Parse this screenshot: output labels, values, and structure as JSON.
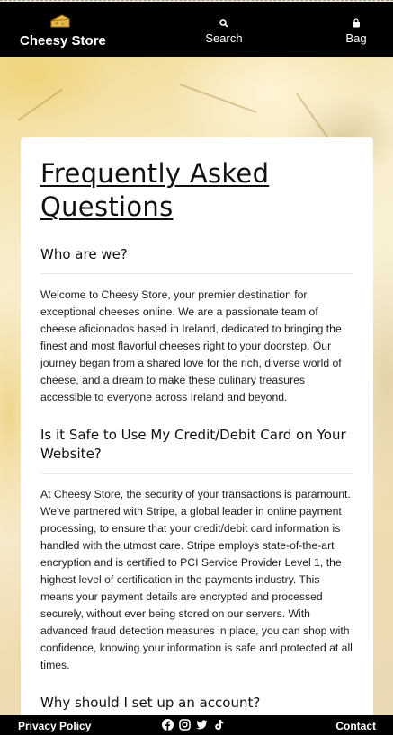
{
  "header": {
    "brand_name": "Cheesy Store",
    "brand_logo": "cheese-icon",
    "search_label": "Search",
    "search_icon": "search-icon",
    "bag_label": "Bag",
    "bag_icon": "bag-icon"
  },
  "main": {
    "title": "Frequently Asked Questions",
    "faqs": [
      {
        "question": "Who are we?",
        "answer": "Welcome to Cheesy Store, your premier destination for exceptional cheeses online. We are a passionate team of cheese aficionados based in Ireland, dedicated to bringing the finest and most flavorful cheeses right to your doorstep. Our journey began from a shared love for the rich, diverse world of cheese, and a dream to make these culinary treasures accessible to everyone across Ireland and beyond."
      },
      {
        "question": "Is it Safe to Use My Credit/Debit Card on Your Website?",
        "answer": "At Cheesy Store, the security of your transactions is paramount. We've partnered with Stripe, a global leader in online payment processing, to ensure that your credit/debit card information is handled with the utmost care. Stripe employs state-of-the-art encryption and is certified to PCI Service Provider Level 1, the highest level of certification in the payments industry. This means your payment details are encrypted and processed securely, without ever being stored on our servers. With advanced fraud detection measures in place, you can shop with confidence, knowing your information is safe and protected at all times."
      },
      {
        "question": "Why should I set up an account?",
        "answer": ""
      }
    ]
  },
  "footer": {
    "privacy_label": "Privacy Policy",
    "contact_label": "Contact",
    "social_icons": [
      "facebook-icon",
      "instagram-icon",
      "twitter-icon",
      "tiktok-icon"
    ]
  },
  "colors": {
    "header_bg": "#000000",
    "footer_bg": "#000000",
    "card_bg": "#ffffff",
    "text": "#111111",
    "logo": "#e9b84a"
  }
}
